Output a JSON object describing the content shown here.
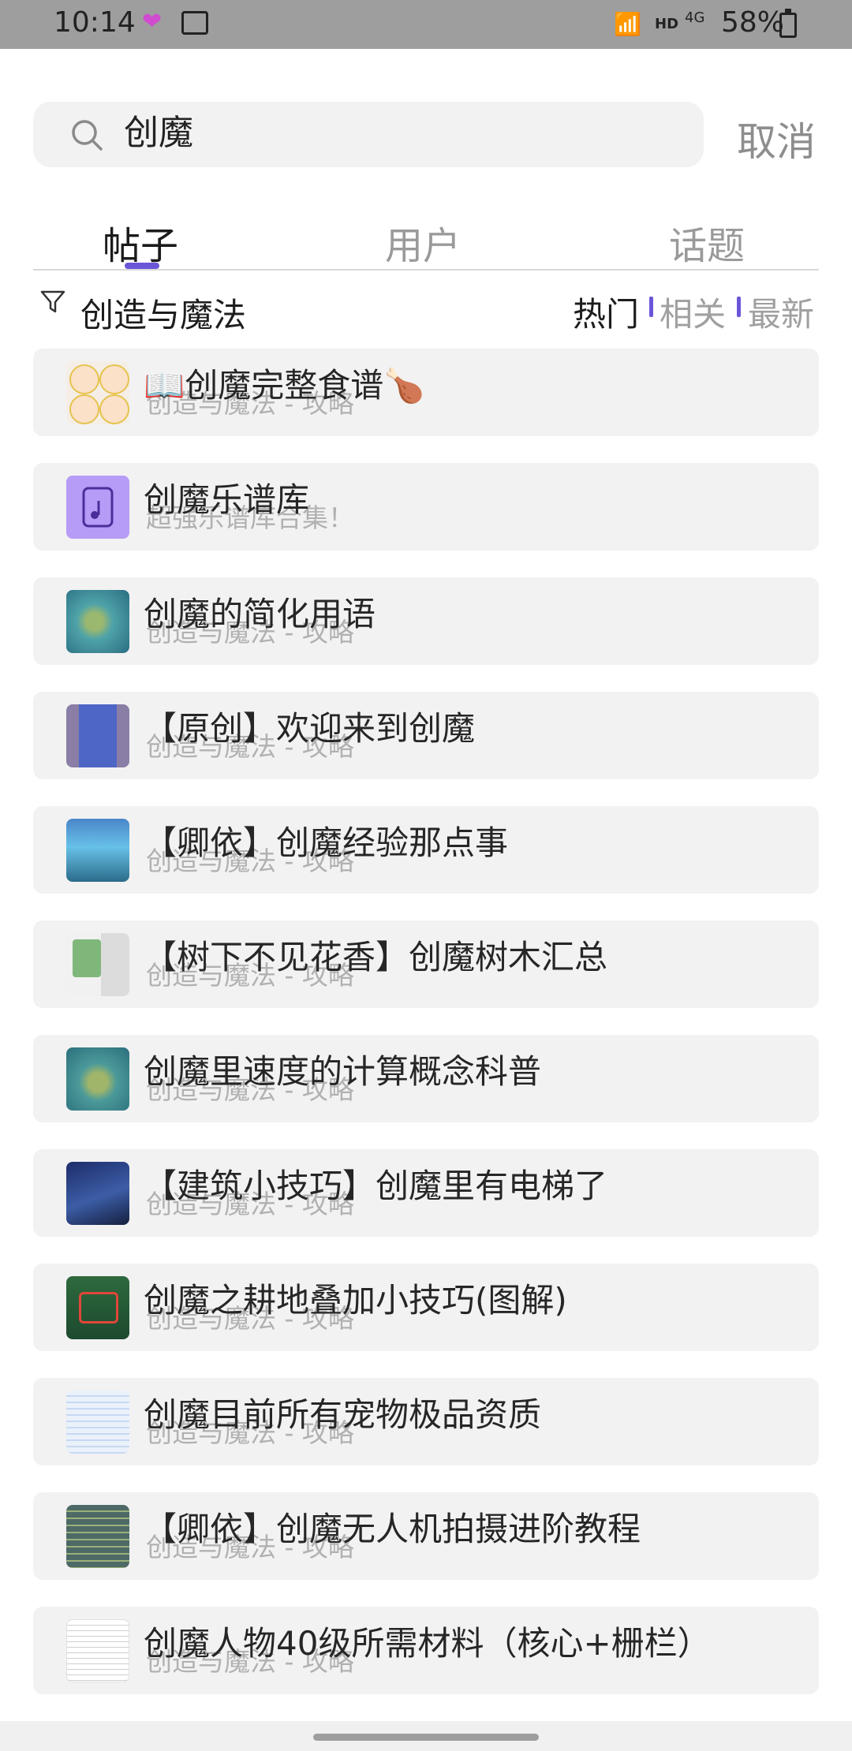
{
  "status_bar": {
    "time": "10:14",
    "network": "HD",
    "signal_type": "4G",
    "battery": "58%"
  },
  "search": {
    "query": "创魔",
    "cancel_label": "取消"
  },
  "tabs": [
    {
      "label": "帖子",
      "active": true
    },
    {
      "label": "用户",
      "active": false
    },
    {
      "label": "话题",
      "active": false
    }
  ],
  "filter": {
    "label": "创造与魔法",
    "sort": {
      "hot": "热门",
      "related": "相关",
      "latest": "最新",
      "selected": "热门"
    }
  },
  "results": [
    {
      "title": "📖创魔完整食谱🍗",
      "subtitle": "创造与魔法 - 攻略",
      "thumb": "chef-avatars"
    },
    {
      "title": "创魔乐谱库",
      "subtitle": "超强乐谱库合集！",
      "thumb": "music-scroll-icon"
    },
    {
      "title": "创魔的简化用语",
      "subtitle": "创造与魔法 - 攻略",
      "thumb": "island-map"
    },
    {
      "title": "【原创】欢迎来到创魔",
      "subtitle": "创造与魔法 - 攻略",
      "thumb": "hallway"
    },
    {
      "title": "【卿依】创魔经验那点事",
      "subtitle": "创造与魔法 - 攻略",
      "thumb": "game-screen"
    },
    {
      "title": "【树下不见花香】创魔树木汇总",
      "subtitle": "创造与魔法 - 攻略",
      "thumb": "tree-chart"
    },
    {
      "title": "创魔里速度的计算概念科普",
      "subtitle": "创造与魔法 - 攻略",
      "thumb": "island-map"
    },
    {
      "title": "【建筑小技巧】创魔里有电梯了",
      "subtitle": "创造与魔法 - 攻略",
      "thumb": "dark-building"
    },
    {
      "title": "创魔之耕地叠加小技巧(图解)",
      "subtitle": "创造与魔法 - 攻略",
      "thumb": "farmland"
    },
    {
      "title": "创魔目前所有宠物极品资质",
      "subtitle": "创造与魔法 - 攻略",
      "thumb": "table"
    },
    {
      "title": "【卿依】创魔无人机拍摄进阶教程",
      "subtitle": "创造与魔法 - 攻略",
      "thumb": "table-dark"
    },
    {
      "title": "创魔人物40级所需材料（核心+栅栏）",
      "subtitle": "创造与魔法 - 攻略",
      "thumb": "document"
    }
  ],
  "colors": {
    "accent": "#6a56d9",
    "card_bg": "#f2f2f2",
    "status_bar_bg": "#9e9e9e"
  }
}
